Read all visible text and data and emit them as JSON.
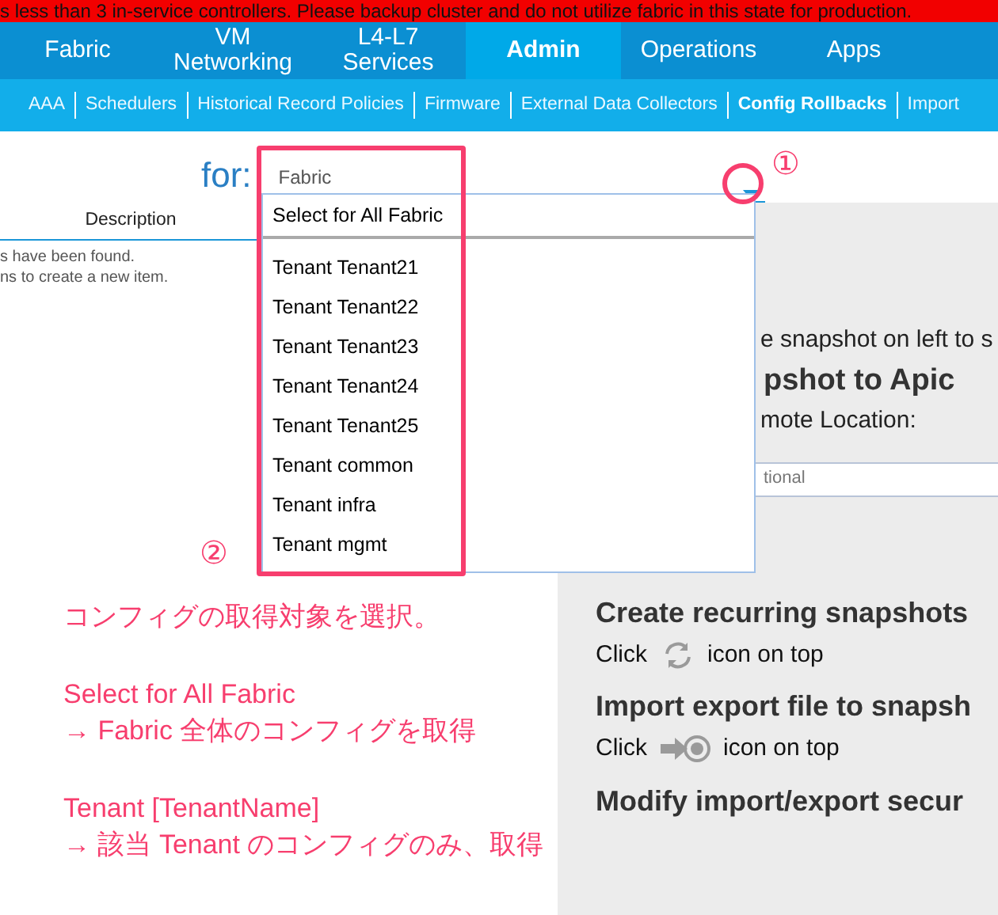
{
  "banner": "s less than 3 in-service controllers. Please backup cluster and do not utilize fabric in this state for production.",
  "nav_tabs": [
    {
      "label": "Fabric",
      "selected": false
    },
    {
      "label": "VM Networking",
      "selected": false
    },
    {
      "label": "L4-L7 Services",
      "selected": false
    },
    {
      "label": "Admin",
      "selected": true
    },
    {
      "label": "Operations",
      "selected": false
    },
    {
      "label": "Apps",
      "selected": false
    }
  ],
  "subnav": [
    {
      "label": "AAA",
      "selected": false
    },
    {
      "label": "Schedulers",
      "selected": false
    },
    {
      "label": "Historical Record Policies",
      "selected": false
    },
    {
      "label": "Firmware",
      "selected": false
    },
    {
      "label": "External Data Collectors",
      "selected": false
    },
    {
      "label": "Config Rollbacks",
      "selected": true
    },
    {
      "label": "Import",
      "selected": false
    }
  ],
  "scope": {
    "label": "for:",
    "value": "Fabric"
  },
  "table": {
    "column": "Description",
    "empty_message": [
      "s have been found.",
      "ns to create a new item."
    ]
  },
  "dropdown": {
    "expanded": true,
    "options": [
      {
        "label": "Select for All Fabric",
        "kind": "all"
      },
      {
        "label": "Tenant Tenant21",
        "kind": "tenant"
      },
      {
        "label": "Tenant Tenant22",
        "kind": "tenant"
      },
      {
        "label": "Tenant Tenant23",
        "kind": "tenant"
      },
      {
        "label": "Tenant Tenant24",
        "kind": "tenant"
      },
      {
        "label": "Tenant Tenant25",
        "kind": "tenant"
      },
      {
        "label": "Tenant common",
        "kind": "tenant"
      },
      {
        "label": "Tenant infra",
        "kind": "tenant"
      },
      {
        "label": "Tenant mgmt",
        "kind": "tenant"
      }
    ]
  },
  "right_panel": [
    {
      "kind": "text",
      "text": "e snapshot on left to s"
    },
    {
      "kind": "heading",
      "text": "pshot to Apic"
    },
    {
      "kind": "text",
      "text": "mote Location:"
    },
    {
      "kind": "field",
      "placeholder": "tional"
    },
    {
      "kind": "section",
      "text": "Create recurring snapshots"
    },
    {
      "kind": "refresh_hint",
      "before": "Click",
      "after": "icon on top"
    },
    {
      "kind": "section",
      "text": "Import export file to snapsh"
    },
    {
      "kind": "import_hint",
      "before": "Click",
      "after": "icon on top"
    },
    {
      "kind": "section",
      "text": "Modify import/export secur"
    }
  ],
  "annotations": {
    "callouts": [
      "①",
      "②"
    ],
    "notes": [
      [
        "コンフィグの取得対象を選択。"
      ],
      [
        "Select for All Fabric",
        "→ Fabric 全体のコンフィグを取得"
      ],
      [
        "Tenant [TenantName]",
        "→ 該当 Tenant のコンフィグのみ、取得"
      ]
    ]
  }
}
